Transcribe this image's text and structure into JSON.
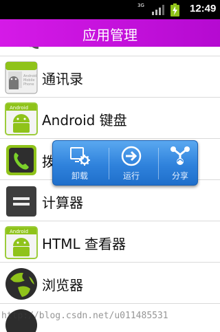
{
  "status_bar": {
    "network": "3G",
    "time": "12:49"
  },
  "title_bar": {
    "title": "应用管理",
    "background": "#c912de"
  },
  "app_list": {
    "items": [
      {
        "label": "",
        "icon": "partial-app-icon"
      },
      {
        "label": "通讯录",
        "icon": "android-robot-icon"
      },
      {
        "label": "Android 键盘",
        "icon": "android-robot-icon"
      },
      {
        "label": "拨号",
        "icon": "phone-icon"
      },
      {
        "label": "计算器",
        "icon": "calculator-icon"
      },
      {
        "label": "HTML 查看器",
        "icon": "android-robot-icon"
      },
      {
        "label": "浏览器",
        "icon": "globe-icon"
      }
    ]
  },
  "popup": {
    "items": [
      {
        "label": "卸载",
        "icon": "uninstall-icon"
      },
      {
        "label": "运行",
        "icon": "run-arrow-icon"
      },
      {
        "label": "分享",
        "icon": "share-icon"
      }
    ],
    "accent": "#2f82dc"
  },
  "watermark": "http://blog.csdn.net/u011485531"
}
